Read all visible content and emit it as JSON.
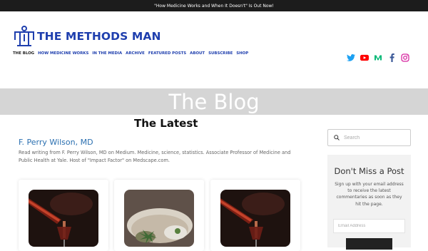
{
  "announcement": "\"How Medicine Works and When It Doesn't\" Is Out Now!",
  "brand": {
    "name": "THE METHODS MAN",
    "color": "#1f3fae"
  },
  "nav": [
    {
      "label": "THE BLOG",
      "active": true
    },
    {
      "label": "HOW MEDICINE WORKS"
    },
    {
      "label": "IN THE MEDIA"
    },
    {
      "label": "ARCHIVE"
    },
    {
      "label": "FEATURED POSTS"
    },
    {
      "label": "ABOUT"
    },
    {
      "label": "SUBSCRIBE"
    },
    {
      "label": "SHOP"
    }
  ],
  "social": [
    {
      "icon": "twitter-icon",
      "color": "#1da1f2"
    },
    {
      "icon": "youtube-icon",
      "color": "#ff0000"
    },
    {
      "icon": "medium-icon",
      "color": "#02b875"
    },
    {
      "icon": "facebook-icon",
      "color": "#3b5998"
    },
    {
      "icon": "instagram-icon",
      "color": "#d6249f"
    }
  ],
  "hero": {
    "title": "The Blog"
  },
  "main": {
    "heading": "The Latest",
    "author": "F. Perry Wilson, MD",
    "description": "Read writing from F. Perry Wilson, MD on Medium. Medicine, science, statistics. Associate Professor of Medicine and Public Health at Yale. Host of \"Impact Factor\" on Medscape.com."
  },
  "cards": [
    {
      "image": "wine-pour-image"
    },
    {
      "image": "cocktail-cannabis-image"
    },
    {
      "image": "wine-pour-image"
    }
  ],
  "sidebar": {
    "search_placeholder": "Search",
    "promo_title": "Don't Miss a Post",
    "promo_text": "Sign up with your email address to receive the latest commentaries as soon as they hit the page.",
    "email_placeholder": "Email Address"
  }
}
